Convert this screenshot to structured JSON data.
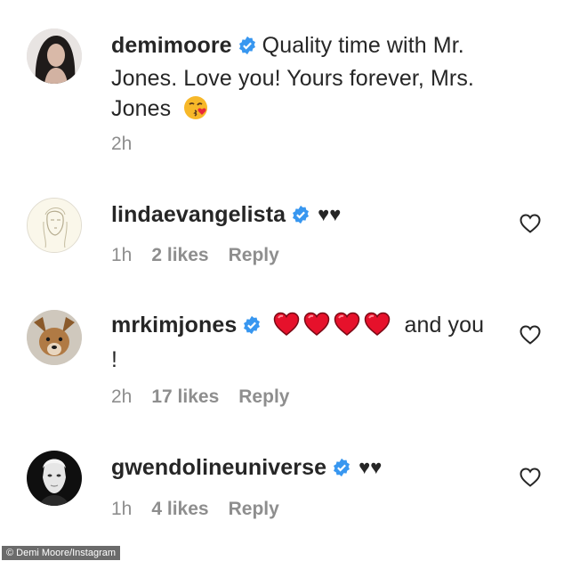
{
  "comments": [
    {
      "username": "demimoore",
      "text": "Quality time with Mr. Jones. Love you! Yours forever, Mrs. Jones",
      "text_line1": "Quality time with Mr.",
      "text_line2": "Jones. Love you! Yours forever, Mrs.",
      "text_line3": "Jones",
      "emoji": "kissing-face-emoji",
      "time": "2h",
      "verified": true
    },
    {
      "username": "lindaevangelista",
      "text": "♥♥",
      "time": "1h",
      "likes": "2 likes",
      "reply": "Reply",
      "verified": true
    },
    {
      "username": "mrkimjones",
      "text_after_hearts": "and you",
      "text_line2": "!",
      "hearts": 4,
      "time": "2h",
      "likes": "17 likes",
      "reply": "Reply",
      "verified": true
    },
    {
      "username": "gwendolineuniverse",
      "text": "♥♥",
      "time": "1h",
      "likes": "4 likes",
      "reply": "Reply",
      "verified": true
    }
  ],
  "photo_credit": "© Demi Moore/Instagram",
  "colors": {
    "verified_blue": "#3897f0",
    "meta_gray": "#8e8e8e",
    "heart_red": "#ed4956"
  }
}
